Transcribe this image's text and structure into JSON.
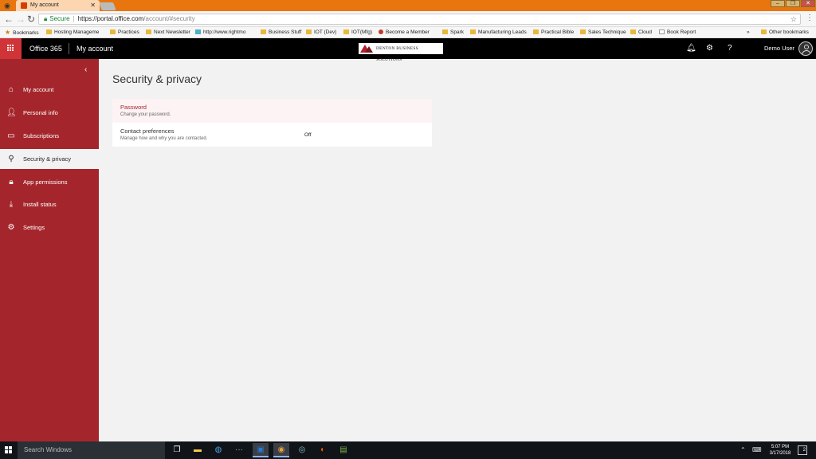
{
  "browser": {
    "tab_title": "My account",
    "url_secure_label": "Secure",
    "url_host": "https://portal.office.com",
    "url_path": "/account/#security",
    "bookmarks": [
      {
        "label": "Bookmarks",
        "type": "star"
      },
      {
        "label": "Hosting Manageme",
        "type": "folder"
      },
      {
        "label": "Practices",
        "type": "folder"
      },
      {
        "label": "Next Newsletter",
        "type": "folder"
      },
      {
        "label": "http://www.rightmo",
        "type": "page"
      },
      {
        "label": "Business Stuff",
        "type": "folder"
      },
      {
        "label": "IOT (Dev)",
        "type": "folder"
      },
      {
        "label": "IOT(Mfg)",
        "type": "folder"
      },
      {
        "label": "Become a Member",
        "type": "page"
      },
      {
        "label": "Spark",
        "type": "folder"
      },
      {
        "label": "Manufacturing Leads",
        "type": "folder"
      },
      {
        "label": "Practical Bible",
        "type": "folder"
      },
      {
        "label": "Sales Technique",
        "type": "folder"
      },
      {
        "label": "Cloud",
        "type": "folder"
      },
      {
        "label": "Book Report",
        "type": "page"
      }
    ],
    "bookmarks_overflow": "»",
    "other_bookmarks": "Other bookmarks"
  },
  "header": {
    "app_name": "Office 365",
    "section": "My account",
    "company_logo_text": "DENTON BUSINESS SOLUTIONS",
    "user_name": "Demo User",
    "help_label": "?"
  },
  "sidebar": {
    "collapse_glyph": "‹",
    "items": [
      {
        "label": "My account",
        "icon": "home-icon"
      },
      {
        "label": "Personal info",
        "icon": "person-icon"
      },
      {
        "label": "Subscriptions",
        "icon": "card-icon"
      },
      {
        "label": "Security & privacy",
        "icon": "key-icon",
        "active": true
      },
      {
        "label": "App permissions",
        "icon": "lock-icon"
      },
      {
        "label": "Install status",
        "icon": "download-icon"
      },
      {
        "label": "Settings",
        "icon": "gear-icon"
      }
    ]
  },
  "main": {
    "title": "Security & privacy",
    "rows": [
      {
        "title": "Password",
        "subtitle": "Change your password.",
        "value": ""
      },
      {
        "title": "Contact preferences",
        "subtitle": "Manage how and why you are contacted.",
        "value": "Off"
      }
    ]
  },
  "taskbar": {
    "search_placeholder": "Search Windows",
    "time": "5:07 PM",
    "date": "3/17/2018",
    "notification_count": "2"
  }
}
